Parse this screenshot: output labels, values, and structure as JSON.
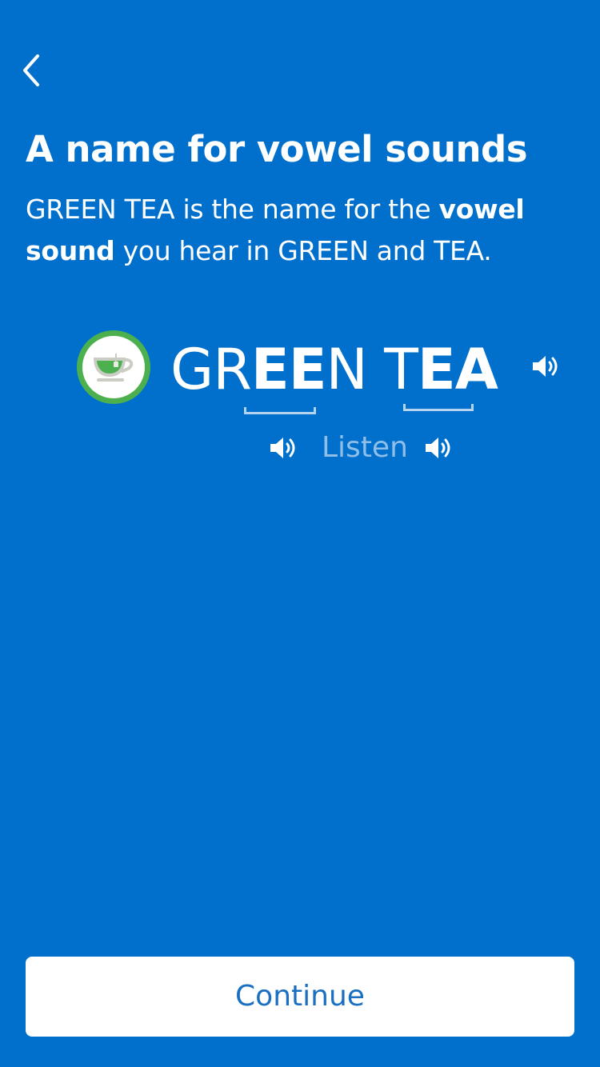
{
  "header": {
    "back_icon": "chevron-left-icon"
  },
  "content": {
    "title": "A name for vowel sounds",
    "description": {
      "part1": "GREEN TEA is the name for the ",
      "bold1": "vowel",
      "space": " ",
      "bold2": "sound",
      "part2": " you hear in GREEN and TEA."
    }
  },
  "sound_card": {
    "icon": "green-tea-cup-icon",
    "word_parts": [
      "GR",
      "EE",
      "N T",
      "EA"
    ],
    "speaker_icon": "speaker-icon",
    "listen_label": "Listen"
  },
  "footer": {
    "continue_label": "Continue"
  },
  "colors": {
    "background": "#0070cc",
    "accent_green": "#4cb04f",
    "button_text": "#1a6fc0",
    "listen_text": "#8fbfe9"
  }
}
